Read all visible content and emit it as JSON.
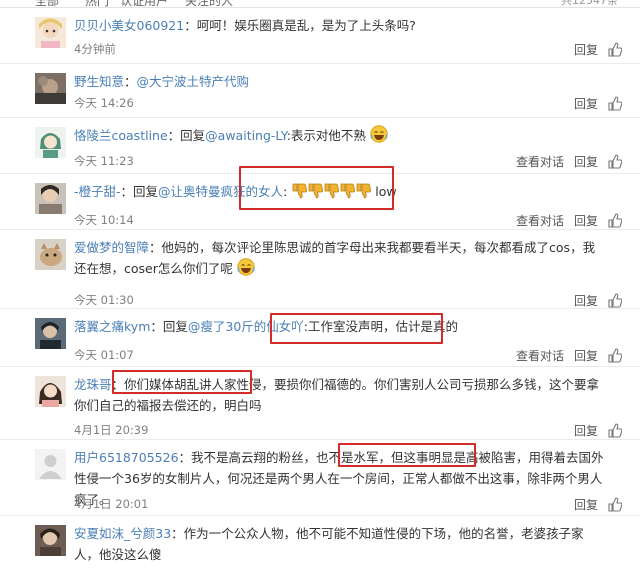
{
  "header": {
    "tab_all": "全部",
    "tab_hot": "热门",
    "tab_authed": "认证用户",
    "tab_follow": "关注的人",
    "count": "共12547条"
  },
  "actions": {
    "reply": "回复",
    "view_conversation": "查看对话"
  },
  "comments": [
    {
      "username": "贝贝小美女060921",
      "sep": "：",
      "content": "呵呵！娱乐圈真是乱，是为了上头条吗?",
      "time": "4分钟前"
    },
    {
      "username": "野生知意",
      "sep": "：",
      "mention": "@大宁波土特产代购",
      "content": "",
      "time": "今天 14:26"
    },
    {
      "username": "恪陵兰coastline",
      "sep": "：回复",
      "mention": "@awaiting-LY",
      "content": ":表示对他不熟",
      "emoji": "laugh-emoji",
      "time": "今天 11:23"
    },
    {
      "username": "-橙子甜-",
      "sep": "：回复",
      "mention": "@让奥特曼疯狂的女人",
      "content": ":",
      "emoji": "thumbs-down-emoji",
      "content_after": "low",
      "time": "今天 10:14"
    },
    {
      "username": "爱做梦的智障",
      "sep": "：",
      "content": "他妈的，每次评论里陈思诚的首字母出来我都要看半天，每次都看成了cos，我还在想，coser怎么你们了呢",
      "emoji": "laugh-emoji",
      "time": "今天 01:30"
    },
    {
      "username": "落翼之痛kym",
      "sep": "：回复",
      "mention": "@瘦了30斤的仙女吖",
      "content": ":工作室没声明，估计是真的",
      "time": "今天 01:07"
    },
    {
      "username": "龙珠哥",
      "sep": "：",
      "content": "你们媒体胡乱讲人家性侵，要损你们福德的。你们害别人公司亏损那么多钱，这个要拿你们自己的福报去偿还的，明白吗",
      "time": "4月1日 20:39"
    },
    {
      "username": "用户6518705526",
      "sep": "：",
      "content": "我不是高云翔的粉丝，也不是水军，但这事明显是高被陷害，用得着去国外性侵一个36岁的女制片人，何况还是两个男人在一个房间，正常人都做不出这事，除非两个男人疯了。",
      "time": "4月1日 20:01"
    },
    {
      "username": "安夏如沫_兮颜33",
      "sep": "：",
      "content": "作为一个公众人物，他不可能不知道性侵的下场，他的名誉，老婆孩子家人，他没这么傻",
      "time": ""
    }
  ],
  "colors": {
    "link_blue": "#4a7fb5",
    "highlight_red": "#d32a2a",
    "thumb_yellow": "#f2b233"
  }
}
